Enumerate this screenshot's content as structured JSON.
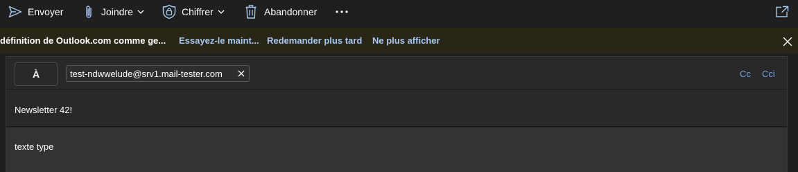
{
  "toolbar": {
    "send_label": "Envoyer",
    "attach_label": "Joindre",
    "encrypt_label": "Chiffrer",
    "discard_label": "Abandonner",
    "more_icon": "more-horizontal-icon",
    "popout_icon": "pop-out-icon"
  },
  "banner": {
    "message": "définition de Outlook.com comme ge...",
    "try_now": "Essayez-le maint...",
    "ask_later": "Redemander plus tard",
    "dont_show": "Ne plus afficher"
  },
  "compose": {
    "to_label": "À",
    "recipient": "test-ndwwelude@srv1.mail-tester.com",
    "cc_label": "Cc",
    "bcc_label": "Cci",
    "subject": "Newsletter 42!",
    "body": "texte type"
  },
  "colors": {
    "background": "#1f1f1f",
    "banner_bg": "#2a2617",
    "link": "#a8c7f0",
    "cc_link": "#6fa8e8"
  }
}
